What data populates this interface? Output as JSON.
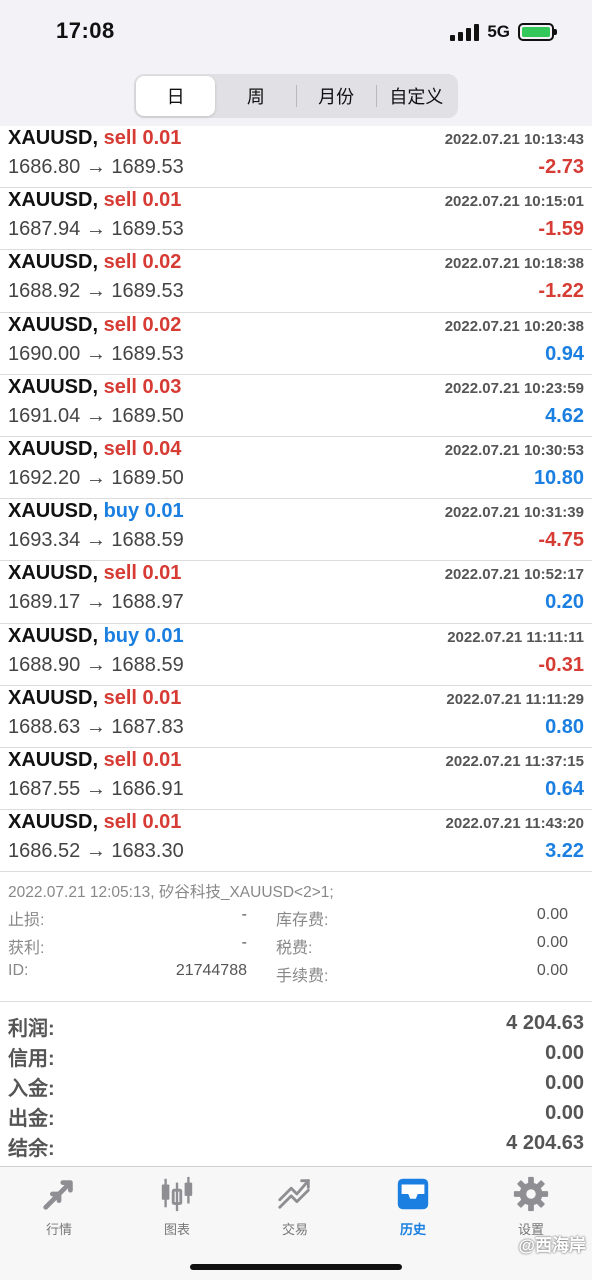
{
  "status_bar": {
    "time": "17:08",
    "network": "5G"
  },
  "period_tabs": [
    {
      "label": "日",
      "active": true
    },
    {
      "label": "周",
      "active": false
    },
    {
      "label": "月份",
      "active": false
    },
    {
      "label": "自定义",
      "active": false
    }
  ],
  "trades": [
    {
      "symbol": "XAUUSD,",
      "side": "sell",
      "volume": "0.01",
      "time": "2022.07.21 10:13:43",
      "prices": "1686.80 → 1689.53",
      "pnl": "-2.73"
    },
    {
      "symbol": "XAUUSD,",
      "side": "sell",
      "volume": "0.01",
      "time": "2022.07.21 10:15:01",
      "prices": "1687.94 → 1689.53",
      "pnl": "-1.59"
    },
    {
      "symbol": "XAUUSD,",
      "side": "sell",
      "volume": "0.02",
      "time": "2022.07.21 10:18:38",
      "prices": "1688.92 → 1689.53",
      "pnl": "-1.22"
    },
    {
      "symbol": "XAUUSD,",
      "side": "sell",
      "volume": "0.02",
      "time": "2022.07.21 10:20:38",
      "prices": "1690.00 → 1689.53",
      "pnl": "0.94"
    },
    {
      "symbol": "XAUUSD,",
      "side": "sell",
      "volume": "0.03",
      "time": "2022.07.21 10:23:59",
      "prices": "1691.04 → 1689.50",
      "pnl": "4.62"
    },
    {
      "symbol": "XAUUSD,",
      "side": "sell",
      "volume": "0.04",
      "time": "2022.07.21 10:30:53",
      "prices": "1692.20 → 1689.50",
      "pnl": "10.80"
    },
    {
      "symbol": "XAUUSD,",
      "side": "buy",
      "volume": "0.01",
      "time": "2022.07.21 10:31:39",
      "prices": "1693.34 → 1688.59",
      "pnl": "-4.75"
    },
    {
      "symbol": "XAUUSD,",
      "side": "sell",
      "volume": "0.01",
      "time": "2022.07.21 10:52:17",
      "prices": "1689.17 → 1688.97",
      "pnl": "0.20"
    },
    {
      "symbol": "XAUUSD,",
      "side": "buy",
      "volume": "0.01",
      "time": "2022.07.21 11:11:11",
      "prices": "1688.90 → 1688.59",
      "pnl": "-0.31"
    },
    {
      "symbol": "XAUUSD,",
      "side": "sell",
      "volume": "0.01",
      "time": "2022.07.21 11:11:29",
      "prices": "1688.63 → 1687.83",
      "pnl": "0.80"
    },
    {
      "symbol": "XAUUSD,",
      "side": "sell",
      "volume": "0.01",
      "time": "2022.07.21 11:37:15",
      "prices": "1687.55 → 1686.91",
      "pnl": "0.64"
    },
    {
      "symbol": "XAUUSD,",
      "side": "sell",
      "volume": "0.01",
      "time": "2022.07.21 11:43:20",
      "prices": "1686.52 → 1683.30",
      "pnl": "3.22"
    }
  ],
  "detail": {
    "header": "2022.07.21 12:05:13, 矽谷科技_XAUUSD<2>1;",
    "rows": [
      {
        "label": "止损:",
        "value": "-",
        "label2": "库存费:",
        "value2": "0.00"
      },
      {
        "label": "获利:",
        "value": "-",
        "label2": "税费:",
        "value2": "0.00"
      },
      {
        "label": "ID:",
        "value": "21744788",
        "label2": "手续费:",
        "value2": "0.00"
      }
    ]
  },
  "summary": [
    {
      "label": "利润:",
      "value": "4 204.63"
    },
    {
      "label": "信用:",
      "value": "0.00"
    },
    {
      "label": "入金:",
      "value": "0.00"
    },
    {
      "label": "出金:",
      "value": "0.00"
    },
    {
      "label": "结余:",
      "value": "4 204.63"
    }
  ],
  "tabbar": [
    {
      "label": "行情",
      "icon": "quotes-arrows-icon",
      "active": false
    },
    {
      "label": "图表",
      "icon": "candlestick-chart-icon",
      "active": false
    },
    {
      "label": "交易",
      "icon": "trade-trend-icon",
      "active": false
    },
    {
      "label": "历史",
      "icon": "history-inbox-icon",
      "active": true
    },
    {
      "label": "设置",
      "icon": "gear-icon",
      "active": false
    }
  ],
  "watermark": "@西海岸",
  "colors": {
    "sell": "#d63b34",
    "buy": "#1a7fe0",
    "active_tab": "#1a7fe0"
  }
}
